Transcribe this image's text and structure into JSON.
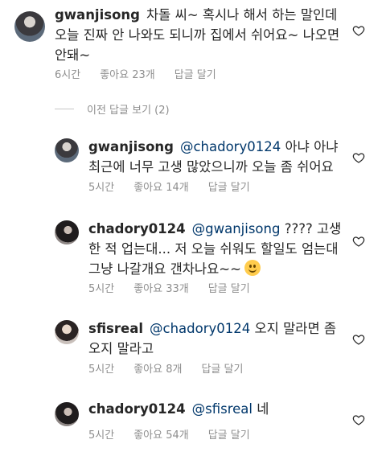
{
  "main_comment": {
    "username": "gwanjisong",
    "text": "차돌 씨~ 혹시나 해서 하는 말인데 오늘 진짜 안 나와도 되니까 집에서 쉬어요~ 나오면 안돼~",
    "time": "6시간",
    "likes": "좋아요 23개",
    "reply": "답글 달기"
  },
  "view_previous_replies": "이전 답글 보기 (2)",
  "replies": [
    {
      "username": "gwanjisong",
      "mention": "@chadory0124",
      "text": " 아냐 아냐 최근에 너무 고생 많았으니까 오늘 좀 쉬어요",
      "time": "5시간",
      "likes": "좋아요 14개",
      "reply": "답글 달기"
    },
    {
      "username": "chadory0124",
      "mention": "@gwanjisong",
      "text": " ???? 고생한 적 업는대... 저 오늘 쉬워도 할일도 엄는대 그냥 나갈개요 갠차나요~~",
      "time": "5시간",
      "likes": "좋아요 33개",
      "reply": "답글 달기"
    },
    {
      "username": "sfisreal",
      "mention": "@chadory0124",
      "text": " 오지 말라면 좀 오지 말라고",
      "time": "5시간",
      "likes": "좋아요 8개",
      "reply": "답글 달기"
    },
    {
      "username": "chadory0124",
      "mention": "@sfisreal",
      "text": " 네",
      "time": "5시간",
      "likes": "좋아요 54개",
      "reply": "답글 달기"
    }
  ],
  "icons": {
    "like": "heart-outline-icon",
    "emoji": "smiling-face-emoji"
  }
}
